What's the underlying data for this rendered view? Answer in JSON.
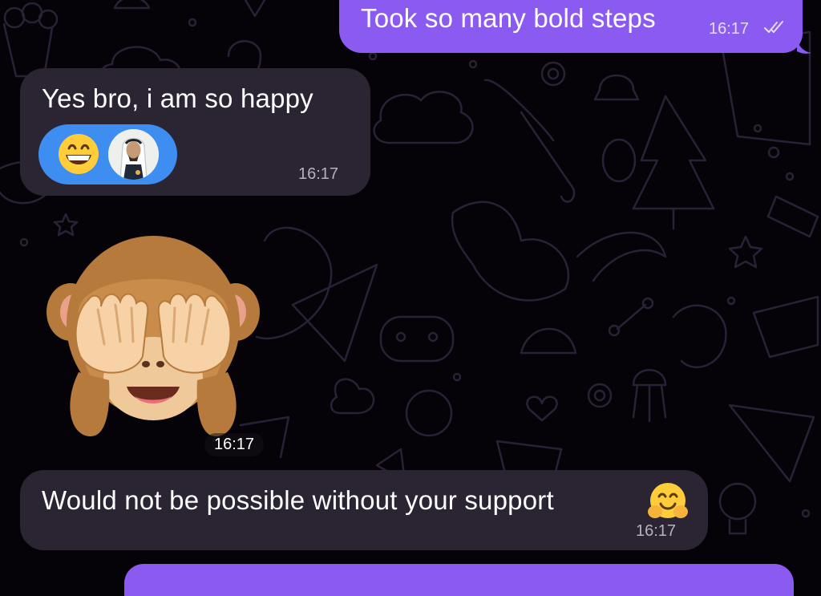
{
  "chat": {
    "messages": [
      {
        "direction": "outgoing",
        "text": "Took so many bold steps",
        "time": "16:17",
        "status_icon": "double-check-icon"
      },
      {
        "direction": "incoming",
        "text": "Yes bro, i am so happy",
        "time": "16:17",
        "reactions": [
          {
            "emoji": "😁",
            "icon": "grinning-face-icon"
          },
          {
            "icon": "reactor-avatar"
          }
        ]
      },
      {
        "direction": "incoming",
        "type": "sticker",
        "sticker_icon": "see-no-evil-monkey-icon",
        "time": "16:17"
      },
      {
        "direction": "incoming",
        "text": "Would not be possible without your support",
        "emoji": "🤗",
        "emoji_icon": "hugging-face-icon",
        "time": "16:17"
      },
      {
        "direction": "outgoing",
        "text": ""
      }
    ]
  },
  "colors": {
    "background": "#050307",
    "outgoing_bubble": "#8b5bf1",
    "incoming_bubble": "#2a2433",
    "reaction_pill": "#3e8ef2",
    "wallpaper_doodles": "#2a2136"
  }
}
